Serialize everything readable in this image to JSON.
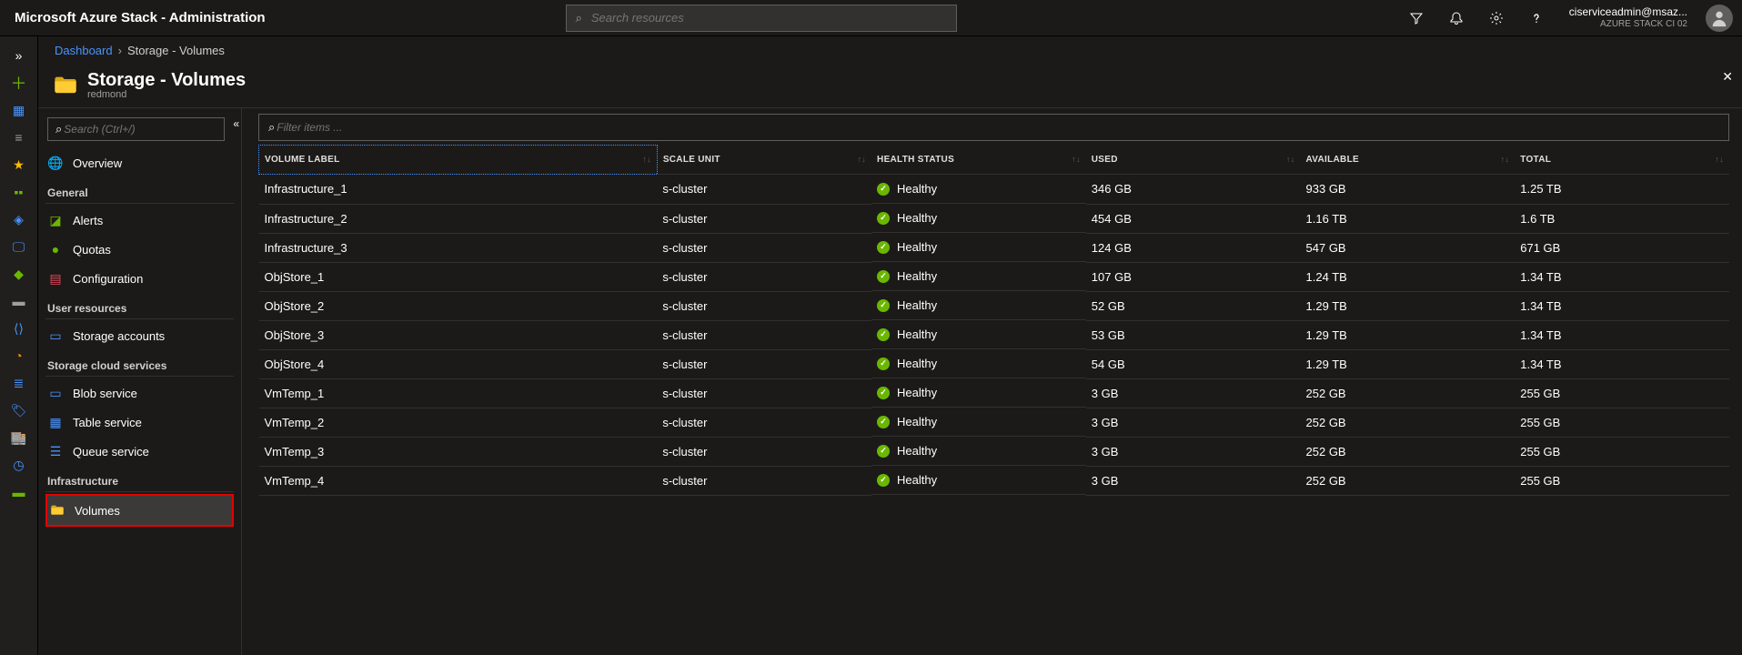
{
  "header": {
    "app_title": "Microsoft Azure Stack - Administration",
    "search_placeholder": "Search resources",
    "user_email": "ciserviceadmin@msaz...",
    "user_sub": "AZURE STACK CI 02"
  },
  "breadcrumb": {
    "root": "Dashboard",
    "current": "Storage - Volumes"
  },
  "blade": {
    "title": "Storage - Volumes",
    "subtitle": "redmond"
  },
  "side_search_placeholder": "Search (Ctrl+/)",
  "nav": {
    "overview": "Overview",
    "sections": {
      "general": "General",
      "user_res": "User resources",
      "cloud": "Storage cloud services",
      "infra": "Infrastructure"
    },
    "items": {
      "alerts": "Alerts",
      "quotas": "Quotas",
      "config": "Configuration",
      "storage_accounts": "Storage accounts",
      "blob": "Blob service",
      "table": "Table service",
      "queue": "Queue service",
      "volumes": "Volumes"
    }
  },
  "filter_placeholder": "Filter items ...",
  "columns": {
    "volume": "VOLUME LABEL",
    "scale": "SCALE UNIT",
    "health": "HEALTH STATUS",
    "used": "USED",
    "available": "AVAILABLE",
    "total": "TOTAL"
  },
  "health_label": "Healthy",
  "rows": [
    {
      "vol": "Infrastructure_1",
      "scale": "s-cluster",
      "used": "346 GB",
      "avail": "933 GB",
      "total": "1.25 TB"
    },
    {
      "vol": "Infrastructure_2",
      "scale": "s-cluster",
      "used": "454 GB",
      "avail": "1.16 TB",
      "total": "1.6 TB"
    },
    {
      "vol": "Infrastructure_3",
      "scale": "s-cluster",
      "used": "124 GB",
      "avail": "547 GB",
      "total": "671 GB"
    },
    {
      "vol": "ObjStore_1",
      "scale": "s-cluster",
      "used": "107 GB",
      "avail": "1.24 TB",
      "total": "1.34 TB"
    },
    {
      "vol": "ObjStore_2",
      "scale": "s-cluster",
      "used": "52 GB",
      "avail": "1.29 TB",
      "total": "1.34 TB"
    },
    {
      "vol": "ObjStore_3",
      "scale": "s-cluster",
      "used": "53 GB",
      "avail": "1.29 TB",
      "total": "1.34 TB"
    },
    {
      "vol": "ObjStore_4",
      "scale": "s-cluster",
      "used": "54 GB",
      "avail": "1.29 TB",
      "total": "1.34 TB"
    },
    {
      "vol": "VmTemp_1",
      "scale": "s-cluster",
      "used": "3 GB",
      "avail": "252 GB",
      "total": "255 GB"
    },
    {
      "vol": "VmTemp_2",
      "scale": "s-cluster",
      "used": "3 GB",
      "avail": "252 GB",
      "total": "255 GB"
    },
    {
      "vol": "VmTemp_3",
      "scale": "s-cluster",
      "used": "3 GB",
      "avail": "252 GB",
      "total": "255 GB"
    },
    {
      "vol": "VmTemp_4",
      "scale": "s-cluster",
      "used": "3 GB",
      "avail": "252 GB",
      "total": "255 GB"
    }
  ]
}
